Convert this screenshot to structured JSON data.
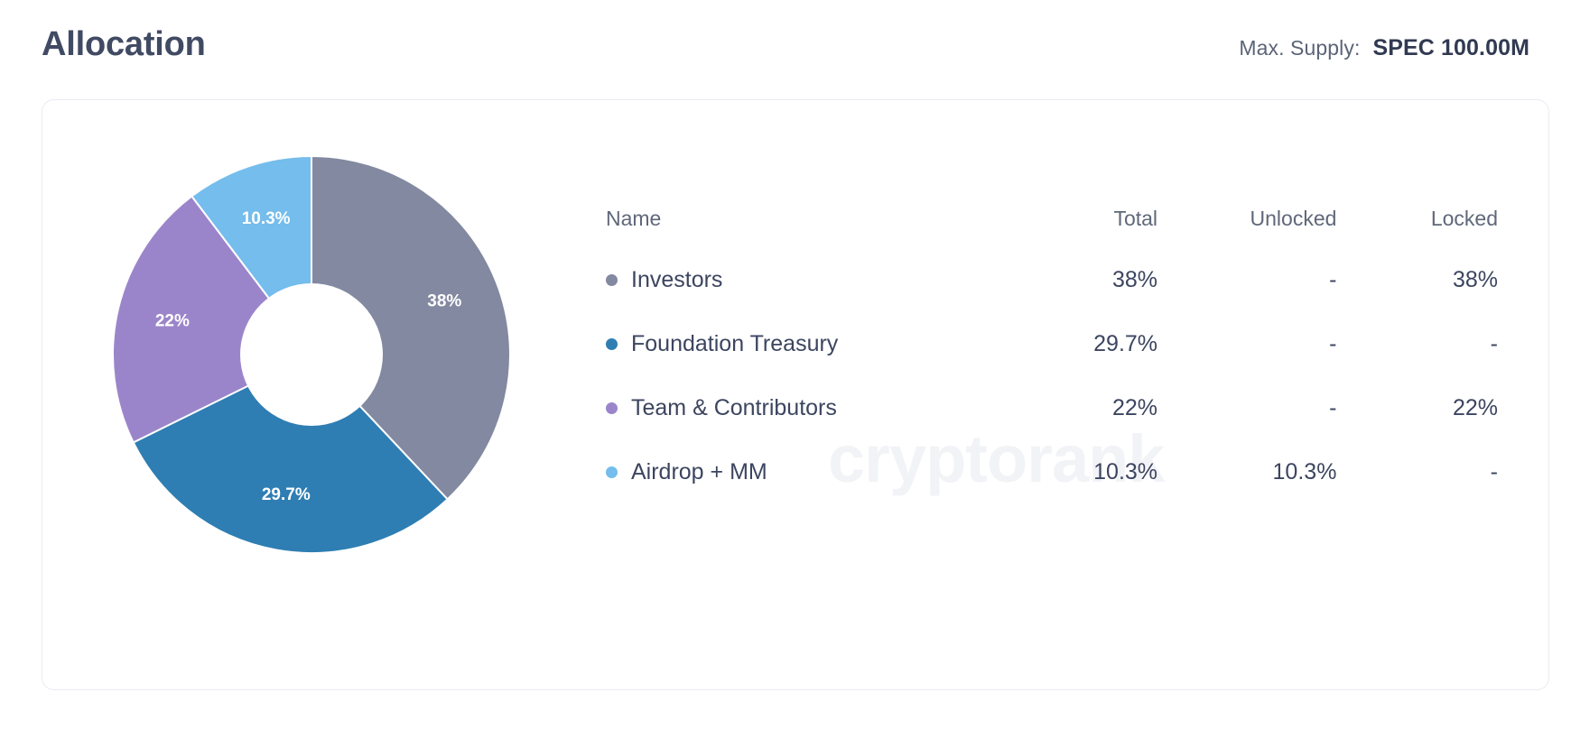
{
  "header": {
    "title": "Allocation",
    "supply_label": "Max. Supply:",
    "supply_value": "SPEC 100.00M"
  },
  "watermark": "cryptorank",
  "table": {
    "columns": {
      "name": "Name",
      "total": "Total",
      "unlocked": "Unlocked",
      "locked": "Locked"
    },
    "rows": [
      {
        "name": "Investors",
        "total": "38%",
        "unlocked": "-",
        "locked": "38%",
        "color": "#8289a0"
      },
      {
        "name": "Foundation Treasury",
        "total": "29.7%",
        "unlocked": "-",
        "locked": "-",
        "color": "#2e7eb3"
      },
      {
        "name": "Team & Contributors",
        "total": "22%",
        "unlocked": "-",
        "locked": "22%",
        "color": "#9b85ca"
      },
      {
        "name": "Airdrop + MM",
        "total": "10.3%",
        "unlocked": "10.3%",
        "locked": "-",
        "color": "#74bdec"
      }
    ]
  },
  "chart_data": {
    "type": "pie",
    "title": "Allocation",
    "variant": "donut",
    "inner_radius_ratio": 0.36,
    "start_angle_deg": 0,
    "direction": "clockwise",
    "labels": [
      "Investors",
      "Foundation Treasury",
      "Team & Contributors",
      "Airdrop + MM"
    ],
    "values": [
      38,
      29.7,
      22,
      10.3
    ],
    "value_labels": [
      "38%",
      "29.7%",
      "22%",
      "10.3%"
    ],
    "colors": [
      "#8289a0",
      "#2e7eb3",
      "#9b85ca",
      "#74bdec"
    ],
    "label_color": "#ffffff",
    "legend_position": "right",
    "grid": false
  }
}
